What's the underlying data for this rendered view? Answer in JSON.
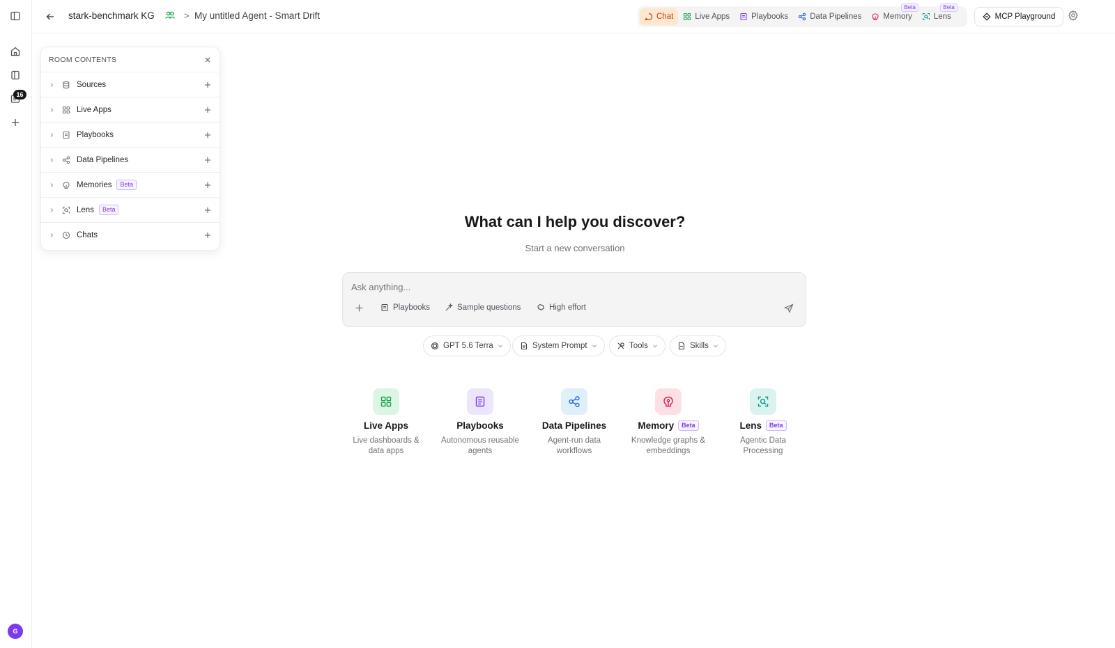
{
  "rail": {
    "badge_count": "16",
    "avatar_initial": "G",
    "icons": [
      "sidebar-toggle-icon",
      "home-icon",
      "book-icon",
      "inbox-icon",
      "plus-icon"
    ]
  },
  "header": {
    "workspace": "stark-benchmark KG",
    "separator": ">",
    "agent_name": "My untitled Agent - Smart Drift",
    "tabs": [
      {
        "label": "Chat",
        "active": true
      },
      {
        "label": "Live Apps"
      },
      {
        "label": "Playbooks"
      },
      {
        "label": "Data Pipelines"
      },
      {
        "label": "Memory",
        "badge": "Beta"
      },
      {
        "label": "Lens",
        "badge": "Beta"
      }
    ],
    "mcp_label": "MCP Playground"
  },
  "panel": {
    "title": "ROOM CONTENTS",
    "items": [
      {
        "label": "Sources"
      },
      {
        "label": "Live Apps"
      },
      {
        "label": "Playbooks"
      },
      {
        "label": "Data Pipelines"
      },
      {
        "label": "Memories",
        "badge": "Beta"
      },
      {
        "label": "Lens",
        "badge": "Beta"
      },
      {
        "label": "Chats"
      }
    ]
  },
  "main": {
    "title": "What can I help you discover?",
    "subtitle": "Start a new conversation",
    "composer": {
      "placeholder": "Ask anything...",
      "tools": [
        "Playbooks",
        "Sample questions",
        "High effort"
      ]
    },
    "pills": [
      "GPT 5.6 Terra",
      "System Prompt",
      "Tools",
      "Skills"
    ],
    "features": [
      {
        "title": "Live Apps",
        "desc": [
          "Live dashboards &",
          "data apps"
        ]
      },
      {
        "title": "Playbooks",
        "desc": [
          "Autonomous reusable",
          "agents"
        ]
      },
      {
        "title": "Data Pipelines",
        "desc": [
          "Agent-run data",
          "workflows"
        ]
      },
      {
        "title": "Memory",
        "badge": "Beta",
        "desc": [
          "Knowledge graphs &",
          "embeddings"
        ]
      },
      {
        "title": "Lens",
        "badge": "Beta",
        "desc": [
          "Agentic Data",
          "Processing"
        ]
      }
    ]
  },
  "colors": {
    "accent_orange": "#c2410c",
    "active_tab_bg": "#fde7cf",
    "beta_purple": "#7c3aed",
    "live_apps_green": "#16a34a",
    "playbooks_purple": "#7c3aed",
    "pipelines_blue": "#2563eb",
    "memory_red": "#e11d48",
    "lens_teal": "#0d9488"
  }
}
